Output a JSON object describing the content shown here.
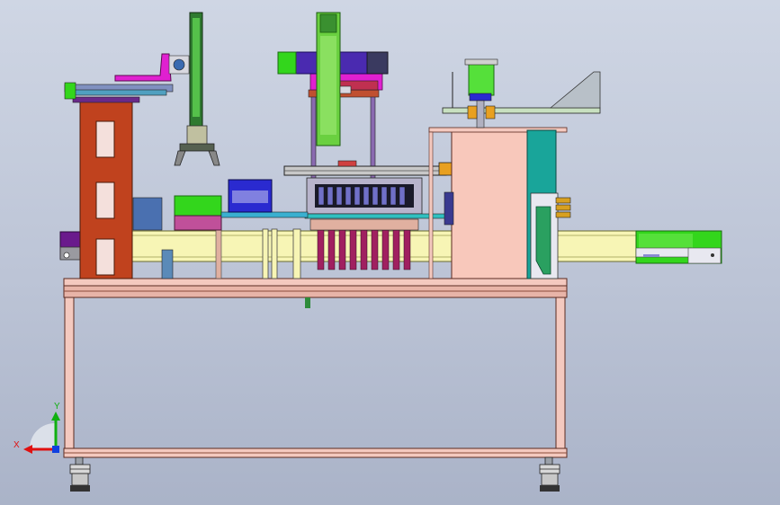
{
  "triad": {
    "x_label": "X",
    "y_label": "Y",
    "x_color": "#e01010",
    "y_color": "#10b010",
    "z_color": "#1040e0"
  },
  "colors": {
    "frame": "#f4c9bf",
    "frame_edge": "#8a4a3a",
    "column": "#c0421e",
    "conveyor": "#f7f5b5",
    "green_part": "#33d61c",
    "magenta_part": "#e020d0",
    "blue_part": "#2a2ad0",
    "purple_part": "#6a1a8c",
    "cyan_part": "#1fb8a8",
    "pink_housing": "#f8c8bb",
    "teal_guard": "#19a59a"
  }
}
